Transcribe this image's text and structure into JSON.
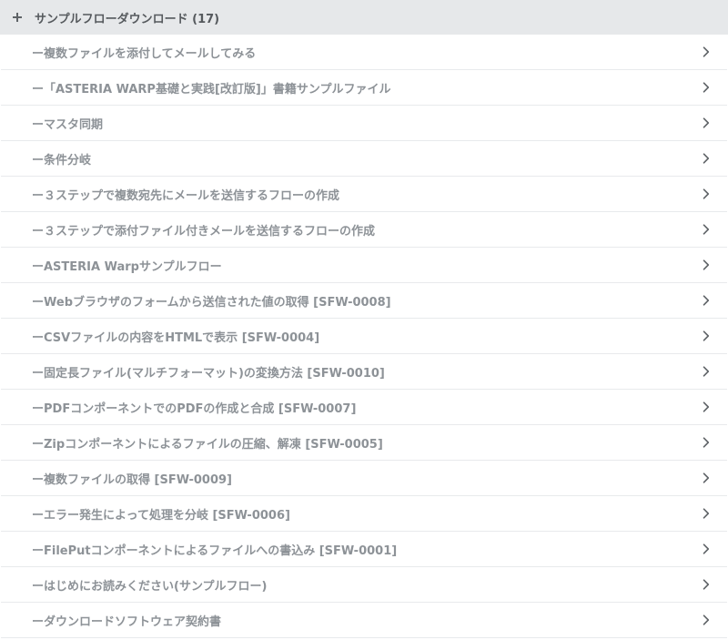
{
  "group": {
    "title": "サンプルフローダウンロード (17)",
    "icon": "plus-icon"
  },
  "items": [
    {
      "label": "ー複数ファイルを添付してメールしてみる"
    },
    {
      "label": "ー「ASTERIA WARP基礎と実践[改訂版]」書籍サンプルファイル"
    },
    {
      "label": "ーマスタ同期"
    },
    {
      "label": "ー条件分岐"
    },
    {
      "label": "ー３ステップで複数宛先にメールを送信するフローの作成"
    },
    {
      "label": "ー３ステップで添付ファイル付きメールを送信するフローの作成"
    },
    {
      "label": "ーASTERIA Warpサンプルフロー"
    },
    {
      "label": "ーWebブラウザのフォームから送信された値の取得 [SFW-0008]"
    },
    {
      "label": "ーCSVファイルの内容をHTMLで表示 [SFW-0004]"
    },
    {
      "label": "ー固定長ファイル(マルチフォーマット)の変換方法 [SFW-0010]"
    },
    {
      "label": "ーPDFコンポーネントでのPDFの作成と合成 [SFW-0007]"
    },
    {
      "label": "ーZipコンポーネントによるファイルの圧縮、解凍 [SFW-0005]"
    },
    {
      "label": "ー複数ファイルの取得 [SFW-0009]"
    },
    {
      "label": "ーエラー発生によって処理を分岐 [SFW-0006]"
    },
    {
      "label": "ーFilePutコンポーネントによるファイルへの書込み [SFW-0001]"
    },
    {
      "label": "ーはじめにお読みください(サンプルフロー)"
    },
    {
      "label": "ーダウンロードソフトウェア契約書"
    }
  ],
  "colors": {
    "header_bg": "#e6e8ea",
    "text": "#8d9297",
    "divider": "#e8eaec",
    "chevron": "#5f6367"
  },
  "row_icon": "chevron-right-icon"
}
